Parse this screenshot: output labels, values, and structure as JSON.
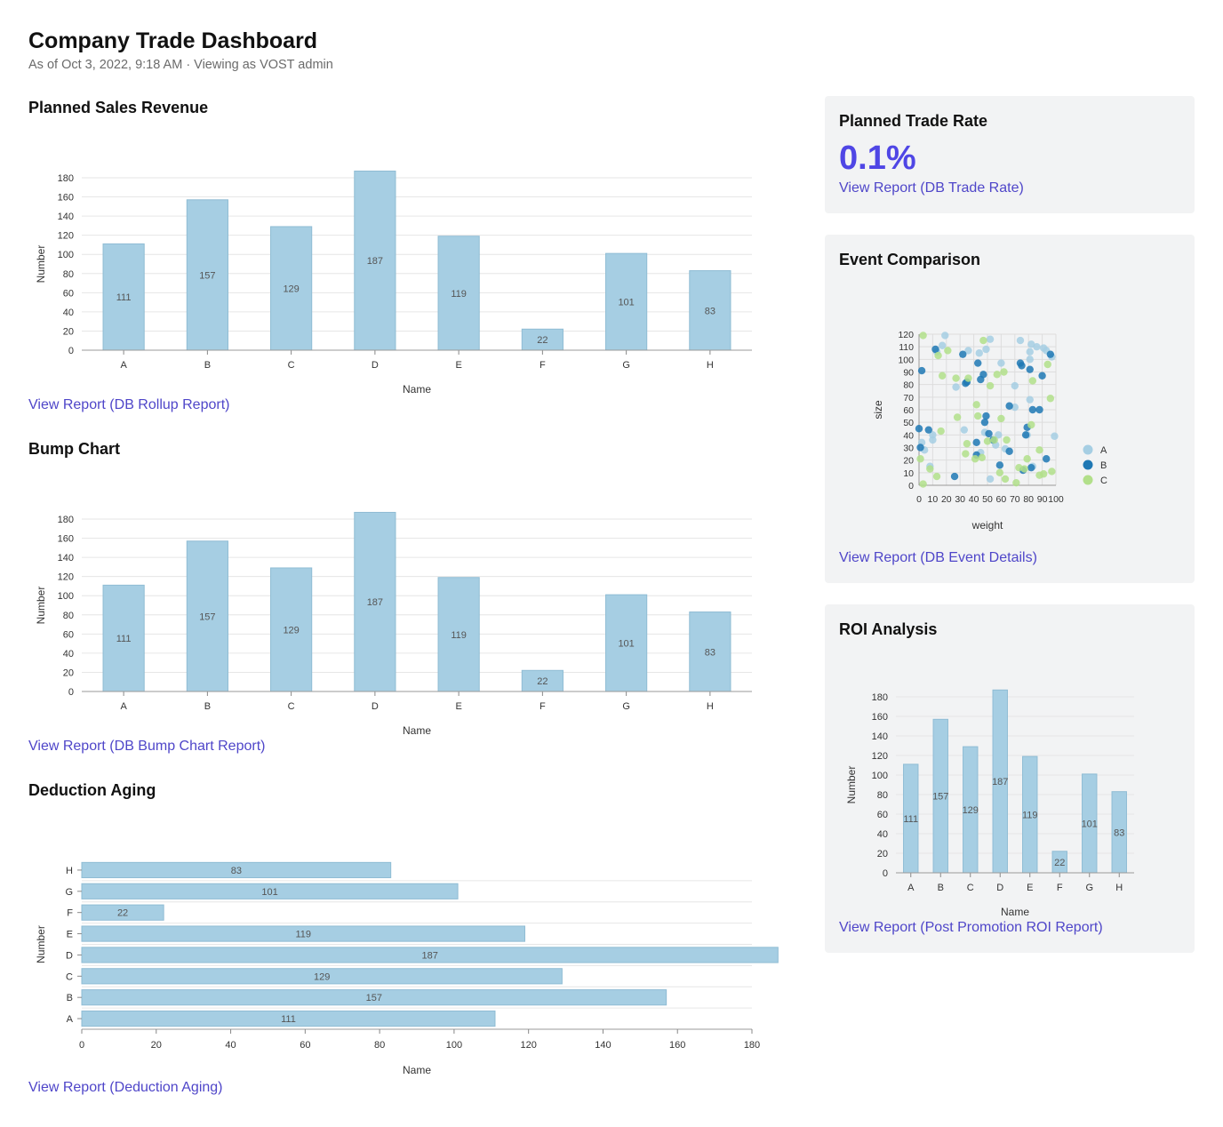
{
  "page": {
    "title": "Company Trade Dashboard",
    "subtitle": "As of Oct 3, 2022, 9:18 AM · Viewing as VOST admin"
  },
  "sections": {
    "planned_sales": {
      "title": "Planned Sales Revenue",
      "link": "View Report (DB Rollup Report)"
    },
    "bump": {
      "title": "Bump Chart",
      "link": "View Report (DB Bump Chart Report)"
    },
    "deduction": {
      "title": "Deduction Aging",
      "link": "View Report (Deduction Aging)"
    }
  },
  "cards": {
    "trade_rate": {
      "title": "Planned Trade Rate",
      "value": "0.1%",
      "link": "View Report (DB Trade Rate)"
    },
    "event": {
      "title": "Event Comparison",
      "link": "View Report (DB Event Details)"
    },
    "roi": {
      "title": "ROI Analysis",
      "link": "View Report (Post Promotion ROI Report)"
    }
  },
  "colors": {
    "bar": "#a6cee3",
    "bar_stroke": "#8fbcd4",
    "link": "#4f46c9",
    "kpi": "#4f46e5",
    "series_A": "#a6cee3",
    "series_B": "#1f78b4",
    "series_C": "#b2df8a"
  },
  "chart_data": [
    {
      "id": "planned_sales",
      "type": "bar",
      "orientation": "vertical",
      "categories": [
        "A",
        "B",
        "C",
        "D",
        "E",
        "F",
        "G",
        "H"
      ],
      "values": [
        111,
        157,
        129,
        187,
        119,
        22,
        101,
        83
      ],
      "xlabel": "Name",
      "ylabel": "Number",
      "ylim": [
        0,
        180
      ],
      "yticks": [
        0,
        20,
        40,
        60,
        80,
        100,
        120,
        140,
        160,
        180
      ],
      "grid": true
    },
    {
      "id": "bump",
      "type": "bar",
      "orientation": "vertical",
      "categories": [
        "A",
        "B",
        "C",
        "D",
        "E",
        "F",
        "G",
        "H"
      ],
      "values": [
        111,
        157,
        129,
        187,
        119,
        22,
        101,
        83
      ],
      "xlabel": "Name",
      "ylabel": "Number",
      "ylim": [
        0,
        180
      ],
      "yticks": [
        0,
        20,
        40,
        60,
        80,
        100,
        120,
        140,
        160,
        180
      ],
      "grid": true
    },
    {
      "id": "deduction",
      "type": "bar",
      "orientation": "horizontal",
      "categories": [
        "A",
        "B",
        "C",
        "D",
        "E",
        "F",
        "G",
        "H"
      ],
      "values": [
        111,
        157,
        129,
        187,
        119,
        22,
        101,
        83
      ],
      "xlabel": "Name",
      "ylabel": "Number",
      "xlim": [
        0,
        180
      ],
      "xticks": [
        0,
        20,
        40,
        60,
        80,
        100,
        120,
        140,
        160,
        180
      ],
      "grid": true
    },
    {
      "id": "event",
      "type": "scatter",
      "xlabel": "weight",
      "ylabel": "size",
      "xlim": [
        0,
        100
      ],
      "ylim": [
        0,
        120
      ],
      "xticks": [
        0,
        10,
        20,
        30,
        40,
        50,
        60,
        70,
        80,
        90,
        100
      ],
      "yticks": [
        0,
        10,
        20,
        30,
        40,
        50,
        60,
        70,
        80,
        90,
        100,
        110,
        120
      ],
      "grid": true,
      "legend_position": "right",
      "series": [
        {
          "name": "A",
          "points": [
            [
              2,
              34
            ],
            [
              4,
              28
            ],
            [
              8,
              15
            ],
            [
              10,
              40
            ],
            [
              10,
              36
            ],
            [
              13,
              106
            ],
            [
              17,
              111
            ],
            [
              19,
              119
            ],
            [
              27,
              78
            ],
            [
              36,
              107
            ],
            [
              44,
              105
            ],
            [
              45,
              26
            ],
            [
              48,
              42
            ],
            [
              49,
              108
            ],
            [
              52,
              116
            ],
            [
              56,
              32
            ],
            [
              58,
              40
            ],
            [
              60,
              97
            ],
            [
              70,
              79
            ],
            [
              74,
              115
            ],
            [
              79,
              40
            ],
            [
              81,
              68
            ],
            [
              81,
              100
            ],
            [
              81,
              106
            ],
            [
              82,
              112
            ],
            [
              86,
              110
            ],
            [
              91,
              109
            ],
            [
              93,
              107
            ],
            [
              97,
              102
            ],
            [
              99,
              39
            ],
            [
              52,
              5
            ],
            [
              63,
              29
            ],
            [
              83,
              15
            ],
            [
              33,
              44
            ],
            [
              70,
              62
            ]
          ]
        },
        {
          "name": "B",
          "points": [
            [
              0,
              45
            ],
            [
              1,
              30
            ],
            [
              2,
              91
            ],
            [
              7,
              44
            ],
            [
              12,
              108
            ],
            [
              26,
              7
            ],
            [
              32,
              104
            ],
            [
              34,
              81
            ],
            [
              35,
              82
            ],
            [
              42,
              24
            ],
            [
              42,
              34
            ],
            [
              43,
              97
            ],
            [
              45,
              84
            ],
            [
              47,
              88
            ],
            [
              48,
              50
            ],
            [
              49,
              55
            ],
            [
              51,
              41
            ],
            [
              54,
              36
            ],
            [
              59,
              16
            ],
            [
              66,
              27
            ],
            [
              66,
              63
            ],
            [
              74,
              97
            ],
            [
              75,
              95
            ],
            [
              76,
              12
            ],
            [
              78,
              40
            ],
            [
              79,
              46
            ],
            [
              81,
              92
            ],
            [
              82,
              14
            ],
            [
              83,
              60
            ],
            [
              88,
              60
            ],
            [
              90,
              87
            ],
            [
              93,
              21
            ],
            [
              96,
              104
            ]
          ]
        },
        {
          "name": "C",
          "points": [
            [
              1,
              21
            ],
            [
              3,
              119
            ],
            [
              3,
              1
            ],
            [
              8,
              13
            ],
            [
              13,
              7
            ],
            [
              14,
              103
            ],
            [
              16,
              43
            ],
            [
              17,
              87
            ],
            [
              21,
              107
            ],
            [
              27,
              85
            ],
            [
              28,
              54
            ],
            [
              34,
              25
            ],
            [
              35,
              33
            ],
            [
              36,
              85
            ],
            [
              42,
              64
            ],
            [
              43,
              55
            ],
            [
              46,
              22
            ],
            [
              47,
              115
            ],
            [
              52,
              79
            ],
            [
              55,
              36
            ],
            [
              57,
              88
            ],
            [
              59,
              10
            ],
            [
              60,
              53
            ],
            [
              62,
              90
            ],
            [
              63,
              5
            ],
            [
              64,
              36
            ],
            [
              71,
              2
            ],
            [
              73,
              14
            ],
            [
              77,
              13
            ],
            [
              79,
              21
            ],
            [
              82,
              48
            ],
            [
              83,
              83
            ],
            [
              88,
              8
            ],
            [
              88,
              28
            ],
            [
              91,
              9
            ],
            [
              94,
              96
            ],
            [
              96,
              69
            ],
            [
              97,
              11
            ],
            [
              41,
              21
            ],
            [
              50,
              35
            ]
          ]
        }
      ]
    },
    {
      "id": "roi",
      "type": "bar",
      "orientation": "vertical",
      "categories": [
        "A",
        "B",
        "C",
        "D",
        "E",
        "F",
        "G",
        "H"
      ],
      "values": [
        111,
        157,
        129,
        187,
        119,
        22,
        101,
        83
      ],
      "xlabel": "Name",
      "ylabel": "Number",
      "ylim": [
        0,
        180
      ],
      "yticks": [
        0,
        20,
        40,
        60,
        80,
        100,
        120,
        140,
        160,
        180
      ],
      "grid": true
    }
  ]
}
